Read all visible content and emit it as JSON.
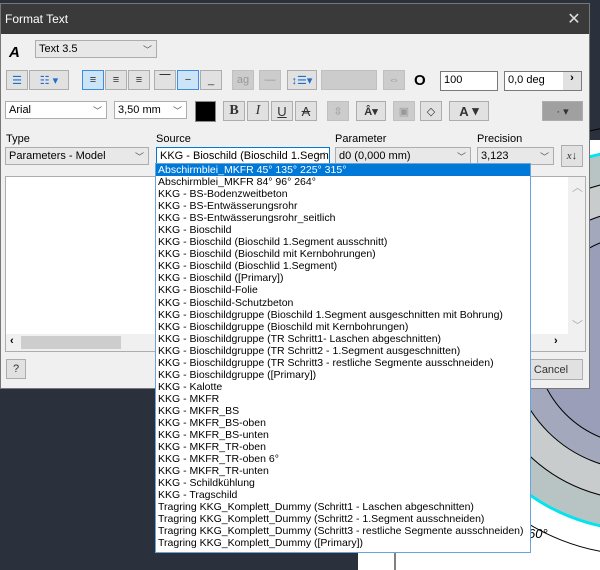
{
  "dialog": {
    "title": "Format Text"
  },
  "style": {
    "value": "Text 3.5"
  },
  "toolbar": {
    "stretch_value": "100",
    "rotation_value": "0,0 deg"
  },
  "font": {
    "name": "Arial",
    "size": "3,50 mm",
    "color": "#000000",
    "bold": "B",
    "italic": "I",
    "underline": "U",
    "strike": "A",
    "text_color_label": "A"
  },
  "fields": {
    "type_label": "Type",
    "type_value": "Parameters - Model",
    "source_label": "Source",
    "source_value": "KKG - Bioschild (Bioschild 1.Segm",
    "parameter_label": "Parameter",
    "parameter_value": "d0 (0,000 mm)",
    "precision_label": "Precision",
    "precision_value": "3,123"
  },
  "buttons": {
    "help": "?",
    "cancel": "Cancel"
  },
  "drawing": {
    "angle_label": "60°"
  },
  "source_options": [
    "Abschirmblei_MKFR 45° 135° 225° 315°",
    "Abschirmblei_MKFR 84° 96° 264°",
    "KKG - BS-Bodenzweitbeton",
    "KKG - BS-Entwässerungsrohr",
    "KKG - BS-Entwässerungsrohr_seitlich",
    "KKG - Bioschild",
    "KKG - Bioschild (Bioschild 1.Segment ausschnitt)",
    "KKG - Bioschild (Bioschild mit Kernbohrungen)",
    "KKG - Bioschild (Bioschlid 1.Segment)",
    "KKG - Bioschild ([Primary])",
    "KKG - Bioschild-Folie",
    "KKG - Bioschild-Schutzbeton",
    "KKG - Bioschildgruppe (Bioschild 1.Segment ausgeschnitten mit Bohrung)",
    "KKG - Bioschildgruppe (Bioschild mit Kernbohrungen)",
    "KKG - Bioschildgruppe (TR Schritt1- Laschen abgeschnitten)",
    "KKG - Bioschildgruppe (TR Schritt2 - 1.Segment ausgeschnitten)",
    "KKG - Bioschildgruppe (TR Schritt3 - restliche Segmente ausschneiden)",
    "KKG - Bioschildgruppe ([Primary])",
    "KKG - Kalotte",
    "KKG - MKFR",
    "KKG - MKFR_BS",
    "KKG - MKFR_BS-oben",
    "KKG - MKFR_BS-unten",
    "KKG - MKFR_TR-oben",
    "KKG - MKFR_TR-oben 6°",
    "KKG - MKFR_TR-unten",
    "KKG - Schildkühlung",
    "KKG - Tragschild",
    "Tragring KKG_Komplett_Dummy (Schritt1 - Laschen abgeschnitten)",
    "Tragring KKG_Komplett_Dummy (Schritt2 - 1.Segment ausschneiden)",
    "Tragring KKG_Komplett_Dummy (Schritt3 - restliche Segmente ausschneiden)",
    "Tragring KKG_Komplett_Dummy ([Primary])"
  ],
  "selected_index": 0
}
